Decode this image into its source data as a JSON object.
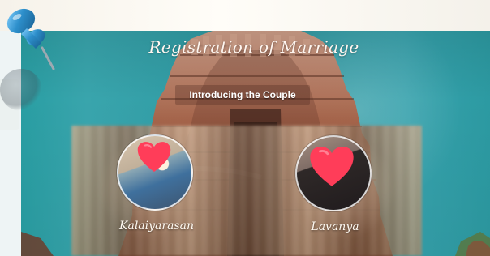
{
  "banner": {
    "title": "Registration of Marriage",
    "subtitle": "Introducing the Couple"
  },
  "couple": {
    "left_name": "Kalaiyarasan",
    "right_name": "Lavanya"
  },
  "icons": {
    "pin": "pushpin-icon",
    "heart": "heart-icon"
  },
  "colors": {
    "sky": "#2aa1a6",
    "tower": "#9e5d43",
    "heart": "#ff3d59",
    "pin": "#2f82b6"
  }
}
